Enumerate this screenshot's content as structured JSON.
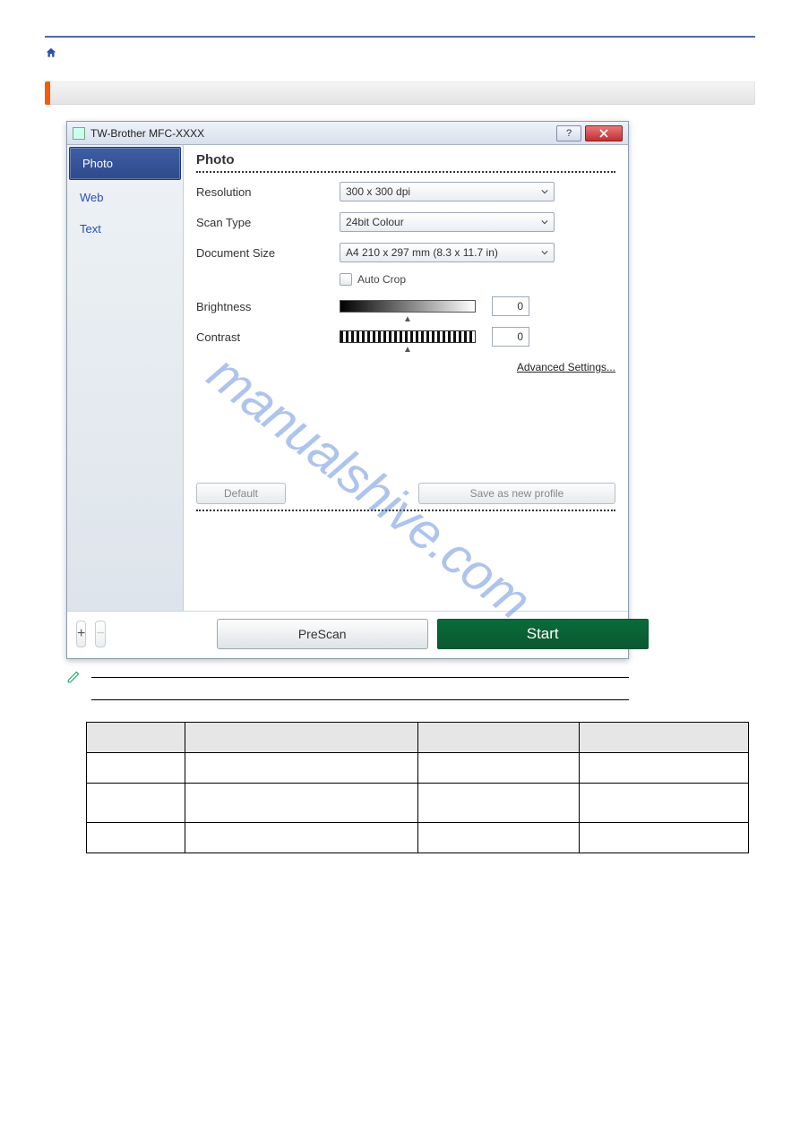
{
  "window": {
    "title": "TW-Brother MFC-XXXX",
    "help_label": "?"
  },
  "sidebar": {
    "tabs": [
      {
        "label": "Photo",
        "active": true
      },
      {
        "label": "Web",
        "active": false
      },
      {
        "label": "Text",
        "active": false
      }
    ]
  },
  "panel": {
    "heading": "Photo",
    "resolution_label": "Resolution",
    "resolution_value": "300 x 300 dpi",
    "scantype_label": "Scan Type",
    "scantype_value": "24bit Colour",
    "docsize_label": "Document Size",
    "docsize_value": "A4 210 x 297 mm (8.3 x 11.7 in)",
    "autocrop_label": "Auto Crop",
    "brightness_label": "Brightness",
    "brightness_value": "0",
    "contrast_label": "Contrast",
    "contrast_value": "0",
    "advanced_link": "Advanced Settings...",
    "default_btn": "Default",
    "save_profile_btn": "Save as new profile",
    "plus_btn": "+",
    "minus_btn": "−",
    "prescan_btn": "PreScan",
    "start_btn": "Start"
  },
  "watermark": "manualshive.com"
}
